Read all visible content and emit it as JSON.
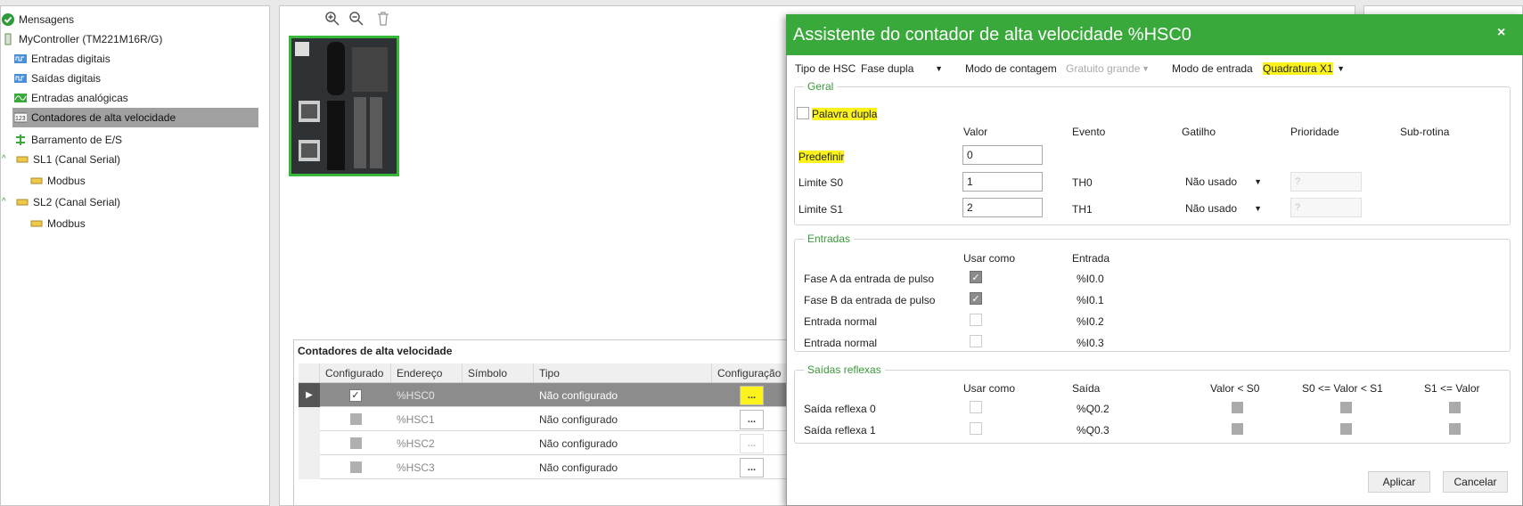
{
  "tree": {
    "items": [
      {
        "label": "Mensagens",
        "icon": "check-circle-icon"
      },
      {
        "label": "MyController (TM221M16R/G)",
        "icon": "controller-icon"
      },
      {
        "label": "Entradas digitais",
        "icon": "digital-input-icon"
      },
      {
        "label": "Saídas digitais",
        "icon": "digital-output-icon"
      },
      {
        "label": "Entradas analógicas",
        "icon": "analog-input-icon"
      },
      {
        "label": "Contadores de alta velocidade",
        "icon": "hsc-icon",
        "selected": true
      },
      {
        "label": "Barramento de E/S",
        "icon": "io-bus-icon"
      },
      {
        "label": "SL1 (Canal Serial)",
        "icon": "serial-icon"
      },
      {
        "label": "Modbus",
        "icon": "modbus-icon"
      },
      {
        "label": "SL2 (Canal Serial)",
        "icon": "serial-icon"
      },
      {
        "label": "Modbus",
        "icon": "modbus-icon"
      }
    ]
  },
  "toolbar": {
    "icons": [
      "zoom-in-icon",
      "zoom-out-icon",
      "trash-icon"
    ]
  },
  "hsc_table": {
    "title": "Contadores de alta velocidade",
    "columns": [
      "Configurado",
      "Endereço",
      "Símbolo",
      "Tipo",
      "Configuração"
    ],
    "rows": [
      {
        "configured": true,
        "address": "%HSC0",
        "symbol": "",
        "type": "Não configurado",
        "config": "..."
      },
      {
        "configured": false,
        "address": "%HSC1",
        "symbol": "",
        "type": "Não configurado",
        "config": "..."
      },
      {
        "configured": false,
        "address": "%HSC2",
        "symbol": "",
        "type": "Não configurado",
        "config": "..."
      },
      {
        "configured": false,
        "address": "%HSC3",
        "symbol": "",
        "type": "Não configurado",
        "config": "..."
      }
    ]
  },
  "dialog": {
    "title": "Assistente do contador de alta velocidade %HSC0",
    "close": "×",
    "hsc_type_label": "Tipo de HSC",
    "hsc_type_value": "Fase dupla",
    "count_mode_label": "Modo de contagem",
    "count_mode_value": "Gratuito grande",
    "input_mode_label": "Modo de entrada",
    "input_mode_value": "Quadratura X1",
    "geral": {
      "title": "Geral",
      "double_word": "Palavra dupla",
      "headers": [
        "Valor",
        "Evento",
        "Gatilho",
        "Prioridade",
        "Sub-rotina"
      ],
      "preset_label": "Predefinir",
      "preset_value": "0",
      "s0_label": "Limite S0",
      "s0_value": "1",
      "s0_event": "TH0",
      "s0_trigger": "Não usado",
      "s0_priority": "?",
      "s1_label": "Limite S1",
      "s1_value": "2",
      "s1_event": "TH1",
      "s1_trigger": "Não usado",
      "s1_priority": "?"
    },
    "entradas": {
      "title": "Entradas",
      "col_use": "Usar como",
      "col_input": "Entrada",
      "rows": [
        {
          "label": "Fase A da entrada de pulso",
          "checked": true,
          "address": "%I0.0"
        },
        {
          "label": "Fase B da entrada de pulso",
          "checked": true,
          "address": "%I0.1"
        },
        {
          "label": "Entrada normal",
          "checked": false,
          "address": "%I0.2"
        },
        {
          "label": "Entrada normal",
          "checked": false,
          "address": "%I0.3"
        }
      ]
    },
    "saidas": {
      "title": "Saídas reflexas",
      "col_use": "Usar como",
      "col_output": "Saída",
      "col_lt_s0": "Valor < S0",
      "col_between": "S0 <= Valor < S1",
      "col_gt_s1": "S1 <= Valor",
      "rows": [
        {
          "label": "Saída reflexa 0",
          "address": "%Q0.2"
        },
        {
          "label": "Saída reflexa 1",
          "address": "%Q0.3"
        }
      ]
    },
    "apply": "Aplicar",
    "cancel": "Cancelar"
  },
  "colors": {
    "accent": "#3aa93c",
    "highlight": "#fbf31b",
    "selection": "#a0a0a0"
  }
}
